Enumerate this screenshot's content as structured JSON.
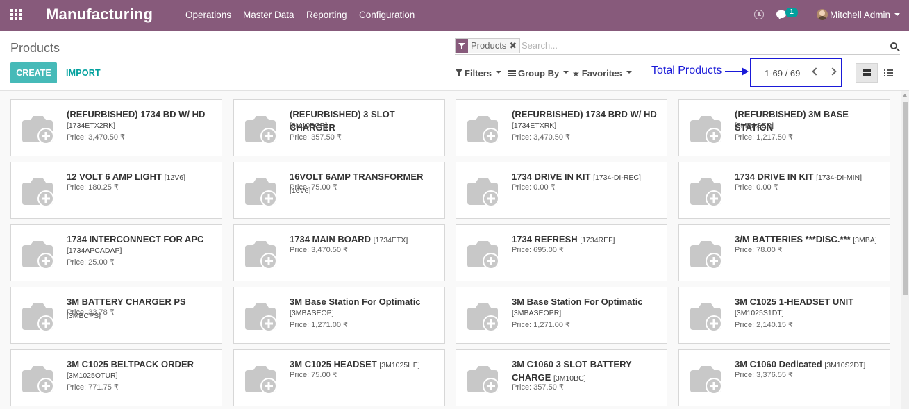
{
  "app": {
    "title": "Manufacturing",
    "menu": [
      "Operations",
      "Master Data",
      "Reporting",
      "Configuration"
    ],
    "chat_count": "1",
    "user_name": "Mitchell Admin"
  },
  "control_panel": {
    "breadcrumb": "Products",
    "search_facet": "Products",
    "search_facet_close": "✖",
    "search_placeholder": "Search...",
    "create_label": "CREATE",
    "import_label": "IMPORT",
    "filters_label": "Filters",
    "group_by_label": "Group By",
    "favorites_label": "Favorites",
    "pager_value": "1-69 / 69",
    "annotation": "Total Products"
  },
  "products": [
    {
      "name": "(REFURBISHED) 1734 BD W/ HD",
      "code": "[1734ETX2RK]",
      "inline_ref": "",
      "price": "Price: 3,470.50 ₹"
    },
    {
      "name": "(REFURBISHED) 3 SLOT CHARGER",
      "code": "[3M10BCR]",
      "inline_ref": "",
      "price": "Price: 357.50 ₹"
    },
    {
      "name": "(REFURBISHED) 1734 BRD W/ HD",
      "code": "[1734ETXRK]",
      "inline_ref": "",
      "price": "Price: 3,470.50 ₹"
    },
    {
      "name": "(REFURBISHED) 3M BASE STATION",
      "code": "[3MBASER]",
      "inline_ref": "",
      "price": "Price: 1,217.50 ₹"
    },
    {
      "name": "12 VOLT 6 AMP LIGHT",
      "code": "",
      "inline_ref": "[12V6]",
      "price": "Price: 180.25 ₹"
    },
    {
      "name": "16VOLT 6AMP TRANSFORMER",
      "code": "",
      "inline_ref": "[16V6]",
      "price": "Price: 75.00 ₹"
    },
    {
      "name": "1734 DRIVE IN KIT",
      "code": "",
      "inline_ref": "[1734-DI-REC]",
      "price": "Price: 0.00 ₹"
    },
    {
      "name": "1734 DRIVE IN KIT",
      "code": "",
      "inline_ref": "[1734-DI-MIN]",
      "price": "Price: 0.00 ₹"
    },
    {
      "name": "1734 INTERCONNECT FOR APC",
      "code": "[1734APCADAP]",
      "inline_ref": "",
      "price": "Price: 25.00 ₹"
    },
    {
      "name": "1734 MAIN BOARD",
      "code": "",
      "inline_ref": "[1734ETX]",
      "price": "Price: 3,470.50 ₹"
    },
    {
      "name": "1734 REFRESH",
      "code": "",
      "inline_ref": "[1734REF]",
      "price": "Price: 695.00 ₹"
    },
    {
      "name": "3/M BATTERIES ***DISC.***",
      "code": "",
      "inline_ref": "[3MBA]",
      "price": "Price: 78.00 ₹"
    },
    {
      "name": "3M BATTERY CHARGER PS",
      "code": "",
      "inline_ref": "[3MBCPS]",
      "price": "Price: 33.78 ₹"
    },
    {
      "name": "3M Base Station For Optimatic",
      "code": "[3MBASEOP]",
      "inline_ref": "",
      "price": "Price: 1,271.00 ₹"
    },
    {
      "name": "3M Base Station For Optimatic",
      "code": "[3MBASEOPR]",
      "inline_ref": "",
      "price": "Price: 1,271.00 ₹"
    },
    {
      "name": "3M C1025 1-HEADSET UNIT",
      "code": "[3M1025S1DT]",
      "inline_ref": "",
      "price": "Price: 2,140.15 ₹"
    },
    {
      "name": "3M C1025 BELTPACK ORDER",
      "code": "[3M1025OTUR]",
      "inline_ref": "",
      "price": "Price: 771.75 ₹"
    },
    {
      "name": "3M C1025 HEADSET",
      "code": "",
      "inline_ref": "[3M1025HE]",
      "price": "Price: 75.00 ₹"
    },
    {
      "name": "3M C1060 3 SLOT BATTERY CHARGE",
      "code": "",
      "inline_ref": "[3M10BC]",
      "price": "Price: 357.50 ₹"
    },
    {
      "name": "3M C1060 Dedicated",
      "code": "",
      "inline_ref": "[3M10S2DT]",
      "price": "Price: 3,376.55 ₹"
    }
  ],
  "colors": {
    "brand": "#875a7b",
    "accent": "#00a09d",
    "annotation": "#1a1ad8"
  }
}
